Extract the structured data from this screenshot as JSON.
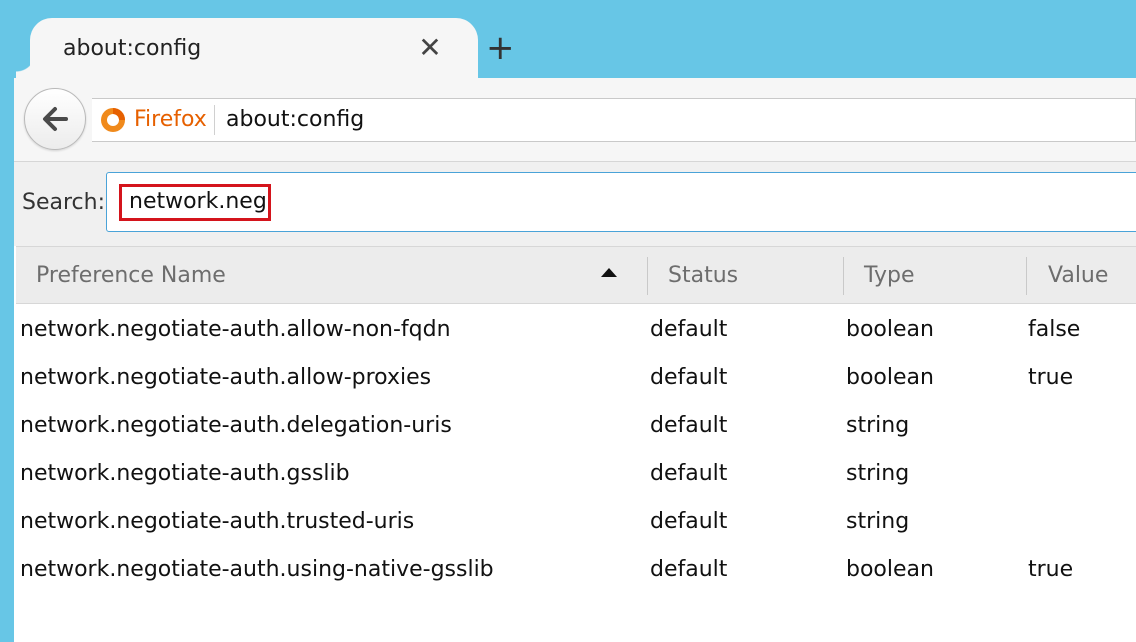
{
  "tab": {
    "title": "about:config",
    "close_glyph": "✕",
    "new_tab_glyph": "+"
  },
  "navbar": {
    "identity_label": "Firefox",
    "url": "about:config"
  },
  "search": {
    "label": "Search:",
    "value": "network.neg"
  },
  "table": {
    "columns": [
      "Preference Name",
      "Status",
      "Type",
      "Value"
    ],
    "sort_column": "Preference Name",
    "sort_direction": "ascending",
    "rows": [
      {
        "name": "network.negotiate-auth.allow-non-fqdn",
        "status": "default",
        "type": "boolean",
        "value": "false"
      },
      {
        "name": "network.negotiate-auth.allow-proxies",
        "status": "default",
        "type": "boolean",
        "value": "true"
      },
      {
        "name": "network.negotiate-auth.delegation-uris",
        "status": "default",
        "type": "string",
        "value": ""
      },
      {
        "name": "network.negotiate-auth.gsslib",
        "status": "default",
        "type": "string",
        "value": ""
      },
      {
        "name": "network.negotiate-auth.trusted-uris",
        "status": "default",
        "type": "string",
        "value": ""
      },
      {
        "name": "network.negotiate-auth.using-native-gsslib",
        "status": "default",
        "type": "boolean",
        "value": "true"
      }
    ]
  },
  "colors": {
    "titlebar": "#67c6e6",
    "identity": "#e66000",
    "highlight": "#d4141c",
    "focus_border": "#4aa3d8"
  }
}
